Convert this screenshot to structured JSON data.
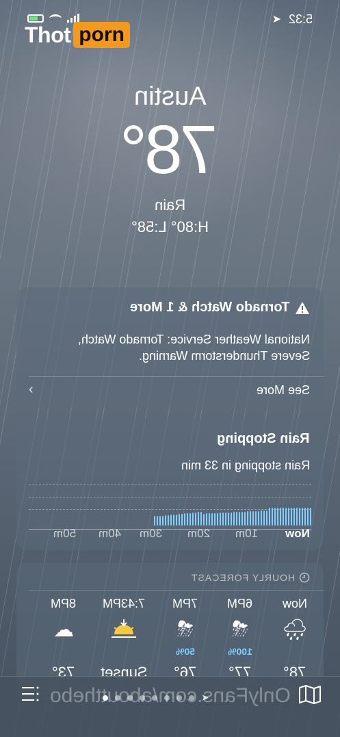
{
  "status_bar": {
    "time": "5:32"
  },
  "logo": {
    "part1": "Thot",
    "part2": "porn"
  },
  "header": {
    "city": "Austin",
    "temperature": "78°",
    "condition": "Rain",
    "high_low": "H:80° L:58°"
  },
  "alert": {
    "title": "Tornado Watch & 1 More",
    "body_line1": "National Weather Service: Tornado Watch,",
    "body_line2": "Severe Thunderstorm Warning.",
    "see_more": "See More"
  },
  "precipitation": {
    "title": "Rain Stopping",
    "subtitle": "Rain stopping in 33 min",
    "tick_labels": [
      "Now",
      "10m",
      "20m",
      "30m",
      "40m",
      "50m"
    ]
  },
  "hourly": {
    "header": "HOURLY FORECAST",
    "items": [
      {
        "time": "Now",
        "icon": "rain-cloud-icon",
        "precip": "",
        "temp": "78°"
      },
      {
        "time": "6PM",
        "icon": "thunderstorm-icon",
        "precip": "100%",
        "temp": "77°"
      },
      {
        "time": "7PM",
        "icon": "thunderstorm-icon",
        "precip": "50%",
        "temp": "76°"
      },
      {
        "time": "7:43PM",
        "icon": "sunset-icon",
        "precip": "",
        "temp": "Sunset"
      },
      {
        "time": "8PM",
        "icon": "partly-cloudy-night-icon",
        "precip": "",
        "temp": "73°"
      }
    ]
  },
  "watermark": "OnlyFans.com/aboutthebo",
  "colors": {
    "precip_accent": "#7fd0ff",
    "logo_accent": "#f39a1c"
  }
}
